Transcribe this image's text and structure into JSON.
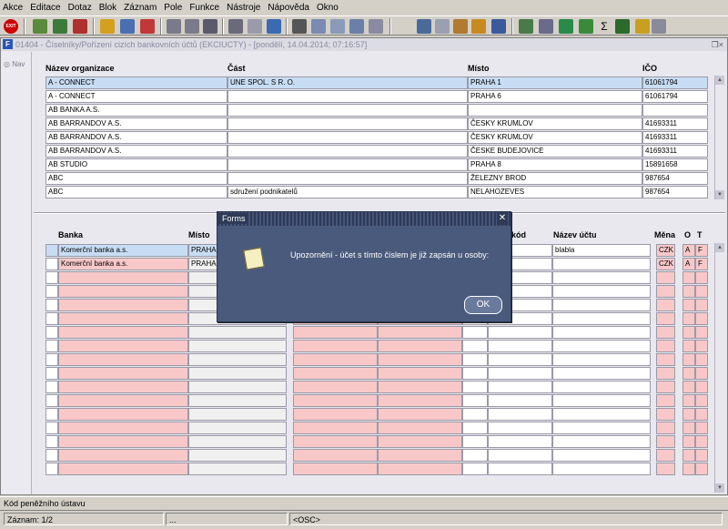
{
  "menu": [
    "Akce",
    "Editace",
    "Dotaz",
    "Blok",
    "Záznam",
    "Pole",
    "Funkce",
    "Nástroje",
    "Nápověda",
    "Okno"
  ],
  "toolbar_icons": [
    "exit-icon",
    "save-icon",
    "new-record-icon",
    "delete-record-icon",
    "enter-query-icon",
    "execute-query-icon",
    "cancel-query-icon",
    "sort-ascending-icon",
    "sort-descending-icon",
    "filter-icon",
    "print-icon",
    "attach-icon",
    "mail-icon",
    "cut-icon",
    "copy-icon",
    "paste-icon",
    "edit-icon",
    "navigate-icon",
    "gear-icon",
    "alert-icon",
    "calculator-icon",
    "report-icon",
    "excel-icon",
    "check-icon",
    "sum-icon",
    "help-icon",
    "context-help-icon"
  ],
  "window": {
    "title": "01404 - Číselníky/Pořízení cizích bankovních účtů (EKCIUCTY) - [pondělí, 14.04.2014; 07:16:57]",
    "nav_label": "Nav"
  },
  "master": {
    "headers": [
      "Název organizace",
      "Část",
      "Místo",
      "IČO"
    ],
    "rows": [
      [
        "A - CONNECT",
        "UNE SPOL. S R. O.",
        "PRAHA 1",
        "61061794"
      ],
      [
        "A - CONNECT",
        "",
        "PRAHA 6",
        "61061794"
      ],
      [
        "AB BANKA A.S.",
        "",
        "",
        ""
      ],
      [
        "AB BARRANDOV A.S.",
        "",
        "ČESKY KRUMLOV",
        "41693311"
      ],
      [
        "AB BARRANDOV A.S.",
        "",
        "ČESKY KRUMLOV",
        "41693311"
      ],
      [
        "AB BARRANDOV A.S.",
        "",
        "ČESKE BUDEJOVICE",
        "41693311"
      ],
      [
        "AB STUDIO",
        "",
        "PRAHA 8",
        "15891658"
      ],
      [
        "ABC",
        "",
        "ŽELEZNY BROD",
        "987654"
      ],
      [
        "ABC",
        "sdružení podnikatelů",
        "NELAHOZEVES",
        "987654"
      ]
    ]
  },
  "detail": {
    "headers": {
      "banka": "Banka",
      "misto": "Místo",
      "kod": "kód",
      "nazev_uctu": "Název účtu",
      "mena": "Měna",
      "o": "O",
      "t": "T"
    },
    "rows": [
      {
        "banka": "Komerční banka a.s.",
        "misto": "PRAHA",
        "nazev_uctu": "blabla",
        "mena": "CZK",
        "o": "A",
        "t": "F"
      },
      {
        "banka": "Komerční banka a.s.",
        "misto": "PRAHA",
        "nazev_uctu": "",
        "mena": "CZK",
        "o": "A",
        "t": "F"
      }
    ]
  },
  "dialog": {
    "title": "Forms",
    "message": "Upozornění - účet s tímto číslem je již zapsán u osoby:",
    "ok_label": "OK"
  },
  "status": {
    "hint": "Kód peněžního ústavu",
    "record": "Záznam: 1/2",
    "dots": "...",
    "osc": "<OSC>"
  }
}
